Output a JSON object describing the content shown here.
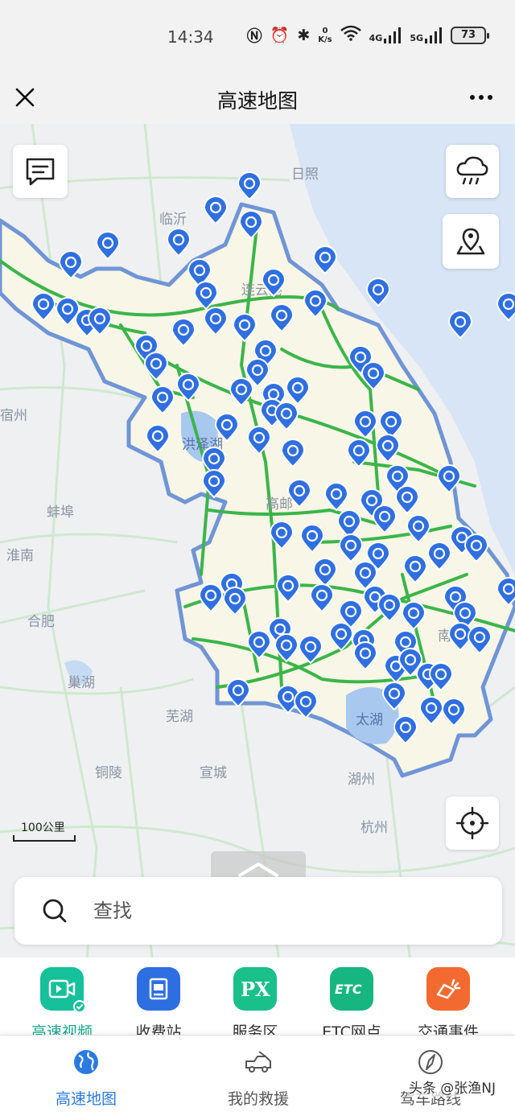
{
  "status": {
    "time": "14:34",
    "net_speed_value": "0",
    "net_speed_unit": "K/s",
    "signal1_label": "4G",
    "signal2_label": "5G",
    "battery": "73"
  },
  "header": {
    "title": "高速地图"
  },
  "map": {
    "place_labels": [
      "日照",
      "临沂",
      "连云港",
      "洪泽湖",
      "宿州",
      "蚌埠",
      "淮南",
      "合肥",
      "巢湖",
      "芜湖",
      "铜陵",
      "宣城",
      "湖州",
      "杭州",
      "太湖",
      "高邮",
      "南通"
    ],
    "scale_label": "100公里",
    "accent_color": "#2f6fe0",
    "province_fill": "#f8f6e6",
    "highway_color": "#3bb54a",
    "water_color": "#a8c8ef"
  },
  "search": {
    "placeholder": "查找"
  },
  "categories": [
    {
      "label": "高速视频",
      "icon": "video-camera-icon",
      "color": "#16c09a"
    },
    {
      "label": "收费站",
      "icon": "toll-station-icon",
      "color": "#2d6fe0"
    },
    {
      "label": "服务区",
      "icon": "service-area-icon",
      "color": "#19c08a"
    },
    {
      "label": "ETC网点",
      "icon": "etc-icon",
      "color": "#17b57f"
    },
    {
      "label": "交通事件",
      "icon": "traffic-event-icon",
      "color": "#f26a30"
    }
  ],
  "tabs": [
    {
      "label": "高速地图",
      "icon": "globe-icon",
      "active": true
    },
    {
      "label": "我的救援",
      "icon": "tow-truck-icon",
      "active": false
    },
    {
      "label": "驾车路线",
      "icon": "compass-icon",
      "active": false
    }
  ],
  "watermark": "头条 @张渔NJ"
}
